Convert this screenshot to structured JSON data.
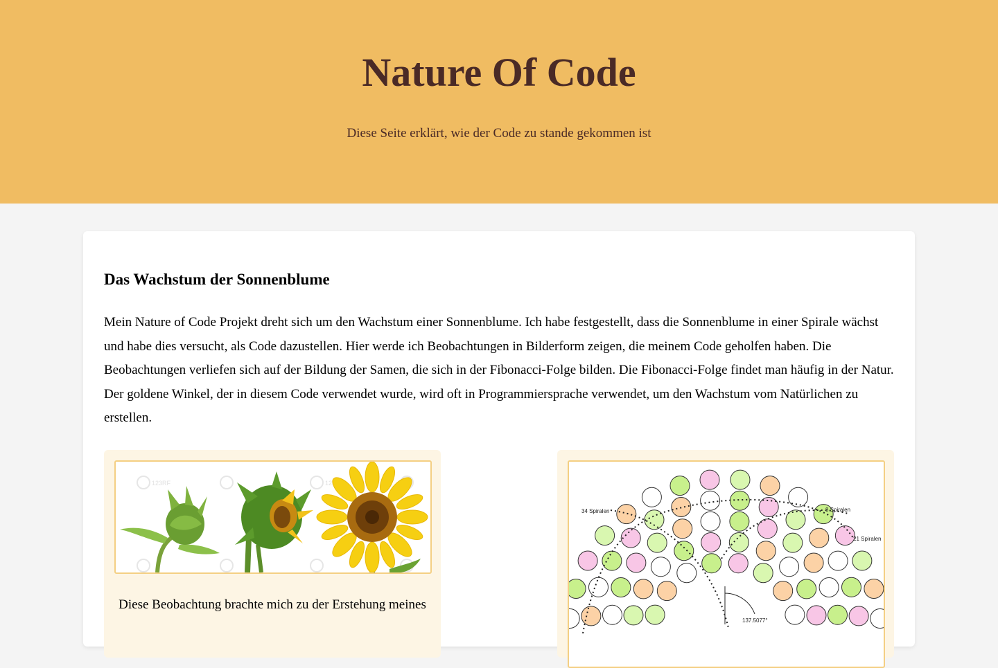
{
  "header": {
    "title": "Nature Of Code",
    "subtitle": "Diese Seite erklärt, wie der Code zu stande gekommen ist"
  },
  "section": {
    "heading": "Das Wachstum der Sonnenblume",
    "paragraph": "Mein Nature of Code Projekt dreht sich um den Wachstum einer Sonnenblume. Ich habe festgestellt, dass die Sonnenblume in einer Spirale wächst und habe dies versucht, als Code dazustellen. Hier werde ich Beobachtungen in Bilderform zeigen, die meinem Code geholfen haben. Die Beobachtungen verliefen sich auf der Bildung der Samen, die sich in der Fibonacci-Folge bilden. Die Fibonacci-Folge findet man häufig in der Natur. Der goldene Winkel, der in diesem Code verwendet wurde, wird oft in Programmiersprache verwendet, um den Wachstum vom Natürlichen zu erstellen."
  },
  "figures": [
    {
      "caption": "Diese Beobachtung brachte mich zu der Erstehung meines",
      "icon": "sunflower-growth-stages-image",
      "watermark": "123RF"
    },
    {
      "icon": "seed-spiral-diagram-image",
      "labels": {
        "spirals_34": "34 Spiralen",
        "spirals_8": "8 Spiralen",
        "spirals_21": "21 Spiralen",
        "angle": "137.5077°"
      }
    }
  ],
  "colors": {
    "hero": "#f0bc62",
    "title": "#4a2a26",
    "figure_bg": "#fdf5e4",
    "frame_border": "#f4cf83"
  }
}
